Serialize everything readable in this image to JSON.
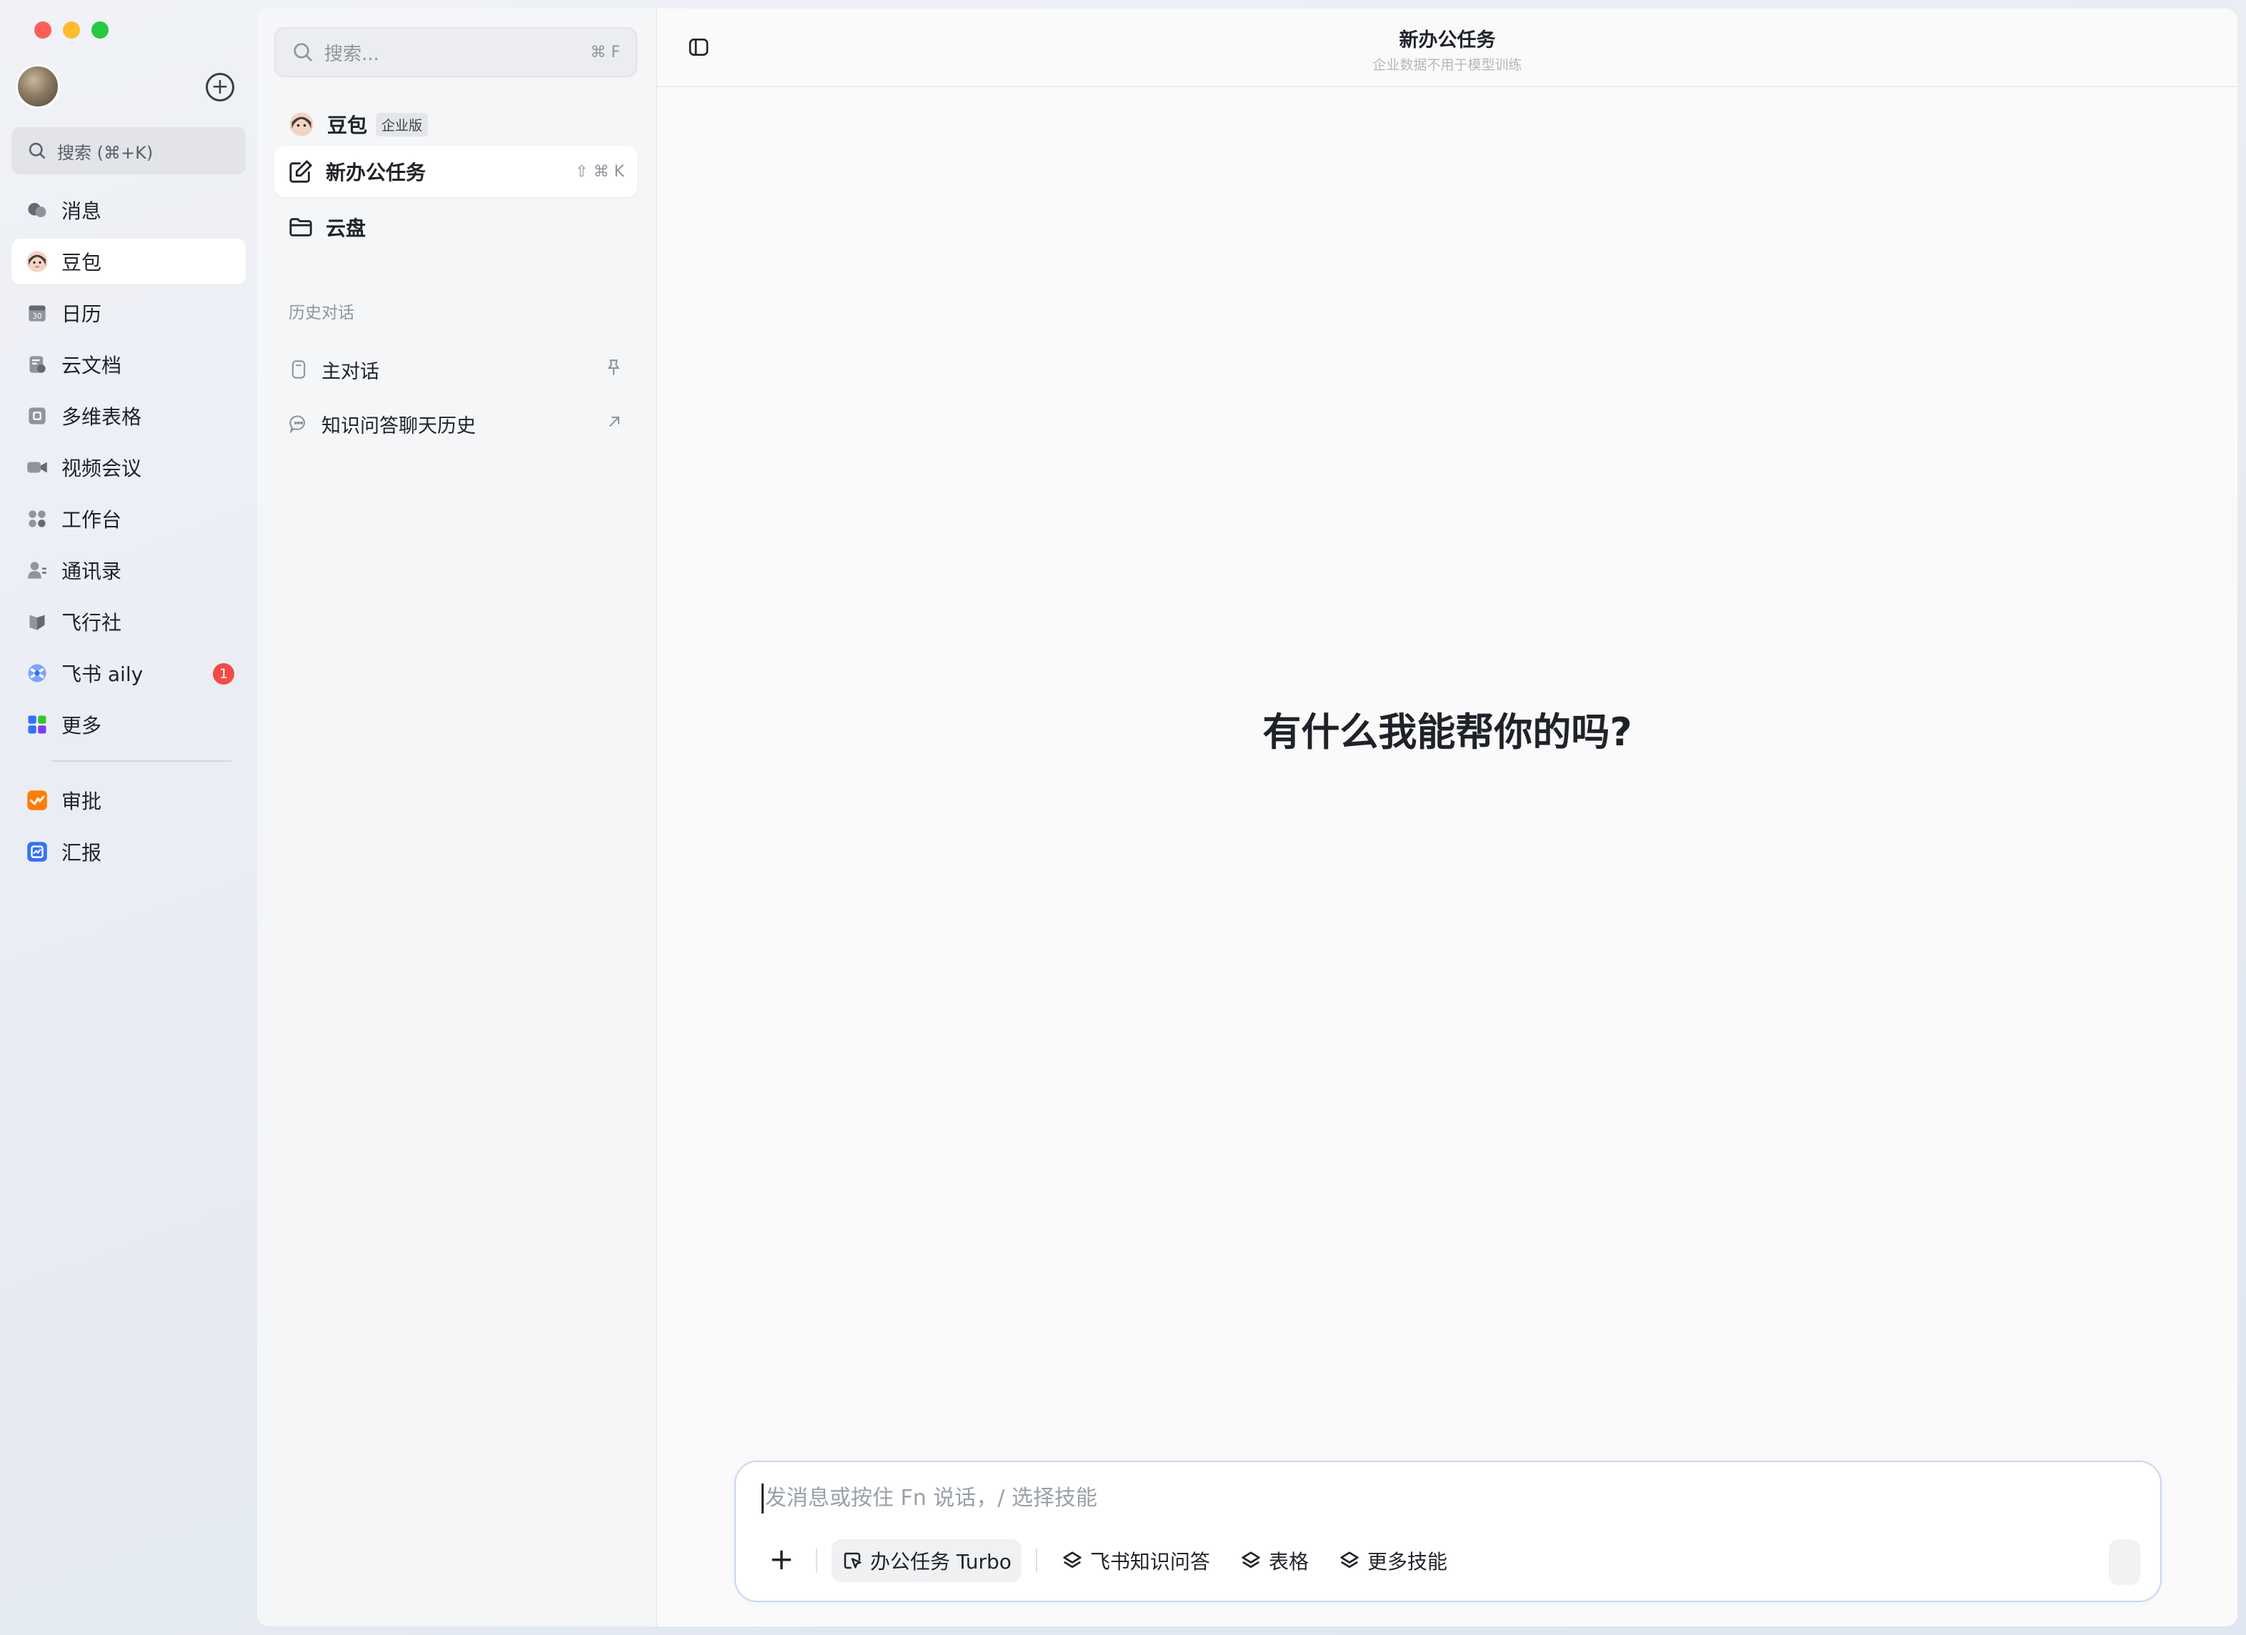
{
  "window": {
    "controls": [
      "close",
      "minimize",
      "zoom"
    ]
  },
  "nav": {
    "search_label": "搜索 (⌘+K)",
    "items": [
      {
        "label": "消息",
        "icon": "message-icon"
      },
      {
        "label": "豆包",
        "icon": "doubao-avatar-icon",
        "active": true
      },
      {
        "label": "日历",
        "icon": "calendar-icon"
      },
      {
        "label": "云文档",
        "icon": "cloud-doc-icon"
      },
      {
        "label": "多维表格",
        "icon": "base-table-icon"
      },
      {
        "label": "视频会议",
        "icon": "video-meeting-icon"
      },
      {
        "label": "工作台",
        "icon": "workplace-icon"
      },
      {
        "label": "通讯录",
        "icon": "contacts-icon"
      },
      {
        "label": "飞行社",
        "icon": "feixingshe-icon"
      },
      {
        "label": "飞书 aily",
        "icon": "aily-icon",
        "badge": "1"
      },
      {
        "label": "更多",
        "icon": "more-apps-icon"
      }
    ],
    "apps": [
      {
        "label": "审批",
        "icon": "approval-icon",
        "color": "#ff7d00"
      },
      {
        "label": "汇报",
        "icon": "report-icon",
        "color": "#3370ff"
      }
    ]
  },
  "mid": {
    "search_placeholder": "搜索...",
    "search_shortcut": "⌘ F",
    "doubao_label": "豆包",
    "doubao_tag": "企业版",
    "new_task_label": "新办公任务",
    "new_task_shortcut": "⇧ ⌘ K",
    "cloud_label": "云盘",
    "history_title": "历史对话",
    "history": [
      {
        "label": "主对话"
      },
      {
        "label": "知识问答聊天历史"
      }
    ]
  },
  "main": {
    "title": "新办公任务",
    "subtitle": "企业数据不用于模型训练",
    "greeting": "有什么我能帮你的吗?",
    "composer_placeholder": "发消息或按住 Fn 说话，/ 选择技能",
    "tools": [
      "办公任务 Turbo",
      "飞书知识问答",
      "表格",
      "更多技能"
    ]
  },
  "colors": {
    "accent": "#3370ff",
    "badge": "#f54a45",
    "approval": "#ff7d00",
    "report": "#3370ff"
  }
}
